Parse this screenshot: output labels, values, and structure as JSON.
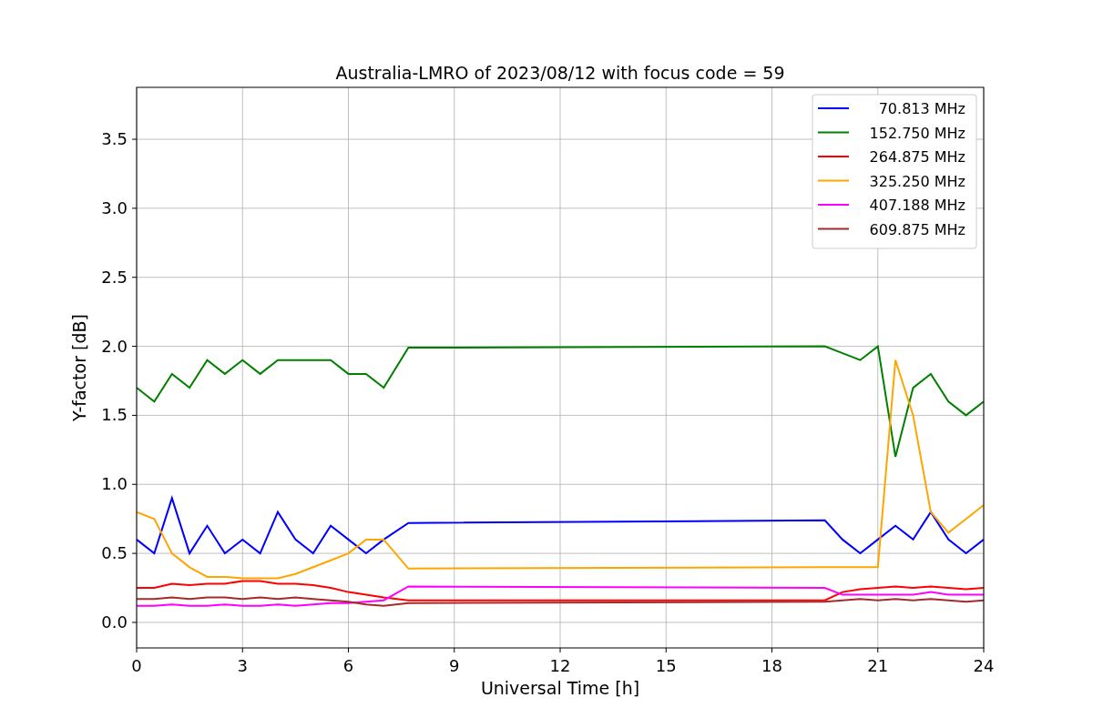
{
  "chart": {
    "chart_data": {
      "type": "line",
      "title": "Australia-LMRO of 2023/08/12 with focus code = 59",
      "xlabel": "Universal Time [h]",
      "ylabel": "Y-factor [dB]",
      "x": [
        0,
        0.5,
        1,
        1.5,
        2,
        2.5,
        3,
        3.5,
        4,
        4.5,
        5,
        5.5,
        6,
        6.5,
        7,
        7.7,
        19.5,
        20,
        20.5,
        21,
        21.5,
        22,
        22.5,
        23,
        23.5,
        24
      ],
      "series": [
        {
          "name": "70.813 MHz",
          "color": "#0000ff",
          "values": [
            0.6,
            0.5,
            0.9,
            0.5,
            0.7,
            0.5,
            0.6,
            0.5,
            0.8,
            0.6,
            0.5,
            0.7,
            0.6,
            0.5,
            0.6,
            0.72,
            0.74,
            0.6,
            0.5,
            0.6,
            0.7,
            0.6,
            0.8,
            0.6,
            0.5,
            0.6
          ]
        },
        {
          "name": "152.750 MHz",
          "color": "#008000",
          "values": [
            1.7,
            1.6,
            1.8,
            1.7,
            1.9,
            1.8,
            1.9,
            1.8,
            1.9,
            1.9,
            1.9,
            1.9,
            1.8,
            1.8,
            1.7,
            1.99,
            2.0,
            1.95,
            1.9,
            2.0,
            1.2,
            1.7,
            1.8,
            1.6,
            1.5,
            1.6
          ]
        },
        {
          "name": "264.875 MHz",
          "color": "#ff0000",
          "values": [
            0.25,
            0.25,
            0.28,
            0.27,
            0.28,
            0.28,
            0.3,
            0.3,
            0.28,
            0.28,
            0.27,
            0.25,
            0.22,
            0.2,
            0.18,
            0.16,
            0.16,
            0.22,
            0.24,
            0.25,
            0.26,
            0.25,
            0.26,
            0.25,
            0.24,
            0.25
          ]
        },
        {
          "name": "325.250 MHz",
          "color": "#ffa500",
          "values": [
            0.8,
            0.75,
            0.5,
            0.4,
            0.33,
            0.33,
            0.32,
            0.32,
            0.32,
            0.35,
            0.4,
            0.45,
            0.5,
            0.6,
            0.6,
            0.39,
            0.4,
            0.4,
            0.4,
            0.4,
            1.9,
            1.5,
            0.8,
            0.65,
            0.75,
            0.85
          ]
        },
        {
          "name": "407.188 MHz",
          "color": "#ff00ff",
          "values": [
            0.12,
            0.12,
            0.13,
            0.12,
            0.12,
            0.13,
            0.12,
            0.12,
            0.13,
            0.12,
            0.13,
            0.14,
            0.14,
            0.15,
            0.16,
            0.26,
            0.25,
            0.2,
            0.2,
            0.2,
            0.2,
            0.2,
            0.22,
            0.2,
            0.2,
            0.2
          ]
        },
        {
          "name": "609.875 MHz",
          "color": "#a52a2a",
          "values": [
            0.17,
            0.17,
            0.18,
            0.17,
            0.18,
            0.18,
            0.17,
            0.18,
            0.17,
            0.18,
            0.17,
            0.16,
            0.15,
            0.13,
            0.12,
            0.14,
            0.15,
            0.16,
            0.17,
            0.16,
            0.17,
            0.16,
            0.17,
            0.16,
            0.15,
            0.16
          ]
        }
      ],
      "xlim": [
        0,
        24
      ],
      "ylim": [
        -0.185,
        3.876
      ],
      "grid": true,
      "legend": "upper right",
      "xticks": [
        0,
        3,
        6,
        9,
        12,
        15,
        18,
        21,
        24
      ],
      "yticks": [
        {
          "value": 0,
          "label": "0.0"
        },
        {
          "value": 0.5,
          "label": "0.5"
        },
        {
          "value": 1,
          "label": "1.0"
        },
        {
          "value": 1.5,
          "label": "1.5"
        },
        {
          "value": 2,
          "label": "2.0"
        },
        {
          "value": 2.5,
          "label": "2.5"
        },
        {
          "value": 3,
          "label": "3.0"
        },
        {
          "value": 3.5,
          "label": "3.5"
        }
      ]
    }
  }
}
